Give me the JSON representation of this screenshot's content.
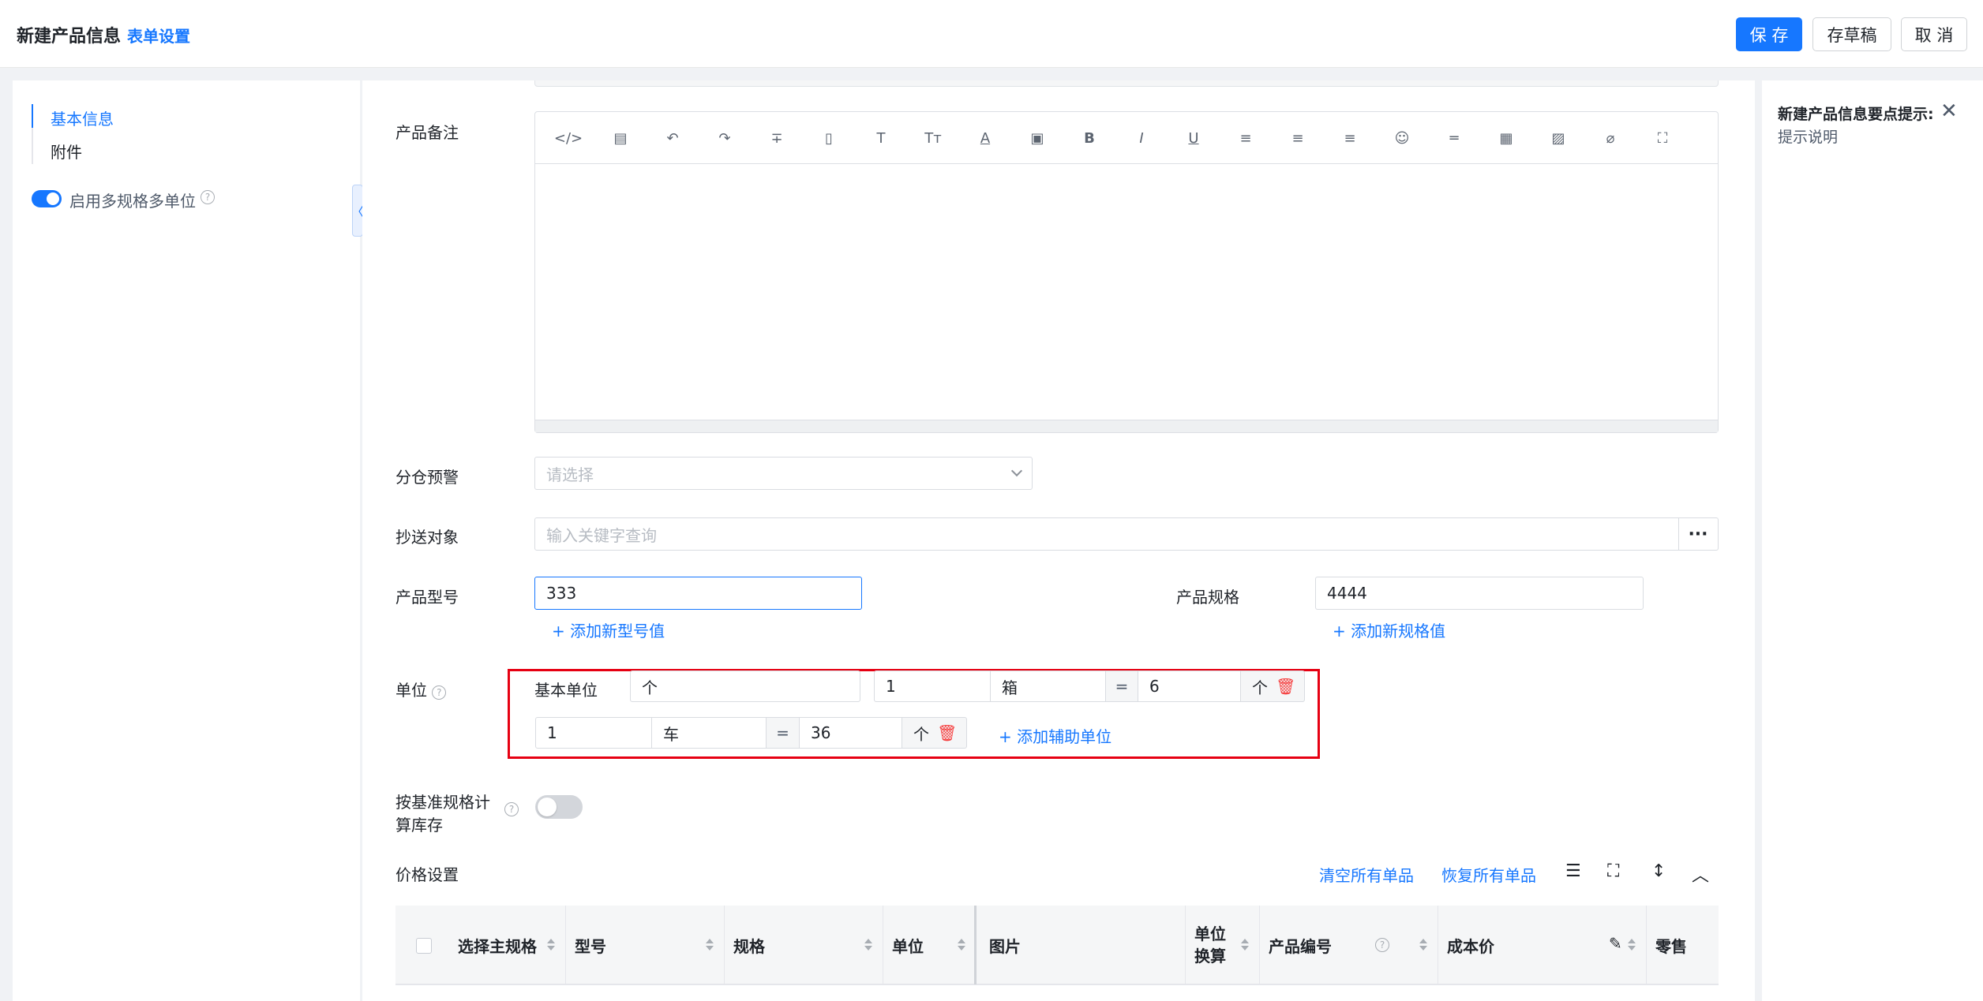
{
  "header": {
    "title": "新建产品信息",
    "form_settings": "表单设置",
    "save": "保 存",
    "draft": "存草稿",
    "cancel": "取 消"
  },
  "sidebar": {
    "anchors": [
      {
        "label": "基本信息",
        "active": true
      },
      {
        "label": "附件",
        "active": false
      }
    ],
    "multi_spec_toggle_label": "启用多规格多单位",
    "multi_spec_enabled": true,
    "collapse_glyph": "〈"
  },
  "form": {
    "remark_label": "产品备注",
    "editor_toolbar": [
      "code-icon",
      "template-icon",
      "undo-icon",
      "redo-icon",
      "strikethrough-icon",
      "document-icon",
      "heading-icon",
      "font-size-icon",
      "font-color-icon",
      "background-color-icon",
      "bold-icon",
      "italic-icon",
      "underline-icon",
      "align-left-icon",
      "align-center-icon",
      "align-right-icon",
      "emoji-icon",
      "divider-icon",
      "table-icon",
      "image-icon",
      "attachment-icon",
      "fullscreen-icon"
    ],
    "warehouse_warning": {
      "label": "分仓预警",
      "placeholder": "请选择"
    },
    "cc_target": {
      "label": "抄送对象",
      "placeholder": "输入关键字查询",
      "more": "···"
    },
    "model": {
      "label": "产品型号",
      "value": "333",
      "add_link": "+ 添加新型号值"
    },
    "spec": {
      "label": "产品规格",
      "value": "4444",
      "add_link": "+ 添加新规格值"
    },
    "unit": {
      "label": "单位",
      "base_unit_label": "基本单位",
      "base_unit_value": "个",
      "row1": {
        "qty": "1",
        "unit": "箱",
        "eq": "=",
        "factor": "6",
        "base": "个"
      },
      "row2": {
        "qty": "1",
        "unit": "车",
        "eq": "=",
        "factor": "36",
        "base": "个"
      },
      "add_aux_link": "+ 添加辅助单位"
    },
    "calc_by_spec": {
      "label_line1": "按基准规格计",
      "label_line2": "算库存",
      "enabled": false
    }
  },
  "price": {
    "title": "价格设置",
    "clear_all": "清空所有单品",
    "restore_all": "恢复所有单品",
    "columns": [
      "选择主规格",
      "型号",
      "规格",
      "单位",
      "图片",
      "单位换算",
      "产品编号",
      "成本价",
      "零售"
    ]
  },
  "tip_panel": {
    "title": "新建产品信息要点提示:",
    "desc": "提示说明",
    "close": "✕"
  },
  "colors": {
    "accent": "#1677ff",
    "highlight": "#e60012",
    "danger": "#f53f3f"
  }
}
